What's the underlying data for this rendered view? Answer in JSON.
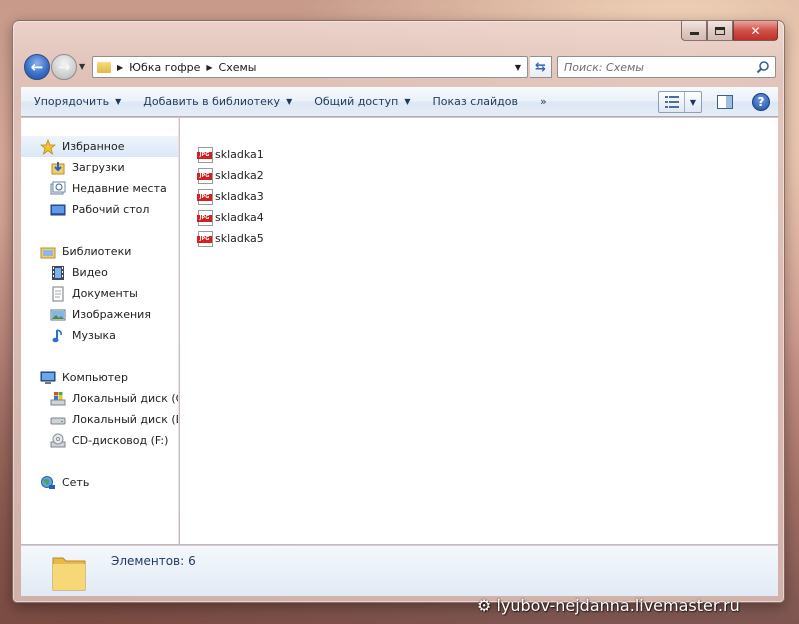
{
  "window": {
    "address": {
      "crumbs": [
        "Юбка гофре",
        "Схемы"
      ]
    },
    "search": {
      "placeholder": "Поиск: Схемы"
    }
  },
  "toolbar": {
    "organize_label": "Упорядочить",
    "add_to_library_label": "Добавить в библиотеку",
    "share_label": "Общий доступ",
    "slideshow_label": "Показ слайдов",
    "more_label": "»"
  },
  "sidebar": {
    "favorites": {
      "label": "Избранное",
      "items": [
        {
          "label": "Загрузки",
          "icon": "downloads-icon"
        },
        {
          "label": "Недавние места",
          "icon": "recent-places-icon"
        },
        {
          "label": "Рабочий стол",
          "icon": "desktop-icon"
        }
      ]
    },
    "libraries": {
      "label": "Библиотеки",
      "items": [
        {
          "label": "Видео",
          "icon": "video-icon"
        },
        {
          "label": "Документы",
          "icon": "documents-icon"
        },
        {
          "label": "Изображения",
          "icon": "pictures-icon"
        },
        {
          "label": "Музыка",
          "icon": "music-icon"
        }
      ]
    },
    "computer": {
      "label": "Компьютер",
      "items": [
        {
          "label": "Локальный диск (C",
          "icon": "windows-drive-icon"
        },
        {
          "label": "Локальный диск (E:",
          "icon": "drive-icon"
        },
        {
          "label": "CD-дисковод (F:)",
          "icon": "cd-drive-icon"
        }
      ]
    },
    "network": {
      "label": "Сеть"
    }
  },
  "files": [
    {
      "name": "skladka1",
      "type": "JPG"
    },
    {
      "name": "skladka2",
      "type": "JPG"
    },
    {
      "name": "skladka3",
      "type": "JPG"
    },
    {
      "name": "skladka4",
      "type": "JPG"
    },
    {
      "name": "skladka5",
      "type": "JPG"
    }
  ],
  "details": {
    "items_label": "Элементов:",
    "items_count": "6"
  },
  "watermark": "lyubov-nejdanna.livemaster.ru",
  "colors": {
    "accent": "#1e395b",
    "selection": "#dbe8f7",
    "jpg_badge": "#d32020",
    "close_button": "#c0302c"
  }
}
